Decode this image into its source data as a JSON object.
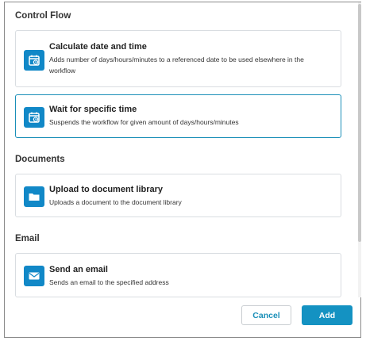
{
  "sections": [
    {
      "title": "Control Flow",
      "items": [
        {
          "title": "Calculate date and time",
          "description": "Adds number of days/hours/minutes to a referenced date to be used elsewhere in the workflow",
          "icon": "calendar-clock-icon"
        },
        {
          "title": "Wait for specific time",
          "description": "Suspends the workflow for given amount of days/hours/minutes",
          "icon": "calendar-clock-icon",
          "selected": true
        }
      ]
    },
    {
      "title": "Documents",
      "items": [
        {
          "title": "Upload to document library",
          "description": "Uploads a document to the document library",
          "icon": "folder-icon"
        }
      ]
    },
    {
      "title": "Email",
      "items": [
        {
          "title": "Send an email",
          "description": "Sends an email to the specified address",
          "icon": "envelope-icon"
        }
      ]
    }
  ],
  "footer": {
    "cancel_label": "Cancel",
    "add_label": "Add"
  },
  "colors": {
    "accent": "#1492c2",
    "icon_bg": "#1188c7",
    "border": "#d9dde1"
  }
}
